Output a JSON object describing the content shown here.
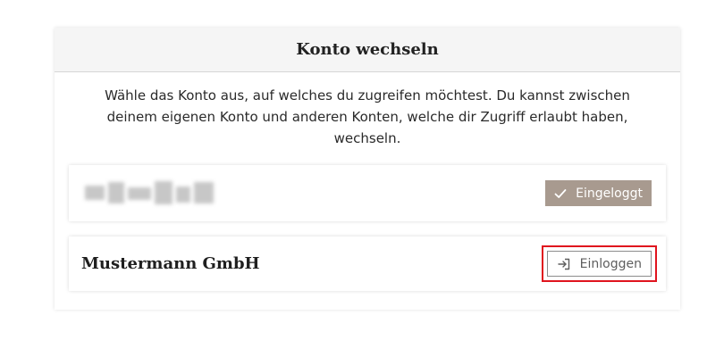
{
  "dialog": {
    "title": "Konto wechseln",
    "intro": "Wähle das Konto aus, auf welches du zugreifen möchtest. Du kannst zwischen deinem eigenen Konto und anderen Konten, welche dir Zugriff erlaubt haben, wechseln."
  },
  "accounts": [
    {
      "name_redacted": true,
      "button_label": "Eingeloggt",
      "button_icon": "check-icon",
      "state": "logged-in"
    },
    {
      "name": "Mustermann GmbH",
      "button_label": "Einloggen",
      "button_icon": "login-icon",
      "state": "available"
    }
  ],
  "colors": {
    "logged_in_button": "#a89a8f",
    "highlight_outline": "#e0141e",
    "header_background": "#f5f5f5"
  }
}
